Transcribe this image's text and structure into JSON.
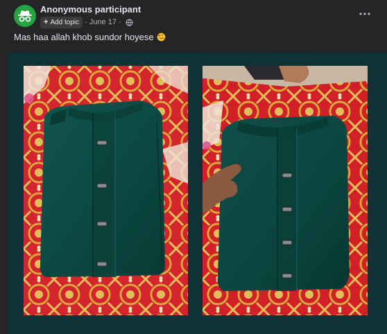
{
  "post": {
    "author": "Anonymous participant",
    "add_topic_label": "Add topic",
    "date": "June 17",
    "separator": "·",
    "text": "Mas haa allah khob sundor hoyese",
    "emoji": "smiling-face-with-hearts"
  },
  "icons": {
    "avatar": "anonymous-incognito-icon",
    "privacy": "globe-icon",
    "more": "more-horizontal-icon"
  },
  "colors": {
    "background": "#242526",
    "avatar_bg": "#24a340",
    "media_bg": "#0f3237",
    "shirt": "#0d4a45",
    "fabric_red": "#d4242d",
    "fabric_gold": "#d8a93a"
  },
  "photos": [
    {
      "subject": "folded teal kurta on red and gold patterned cloth"
    },
    {
      "subject": "hand holding folded teal kurta on red and gold patterned cloth"
    }
  ]
}
